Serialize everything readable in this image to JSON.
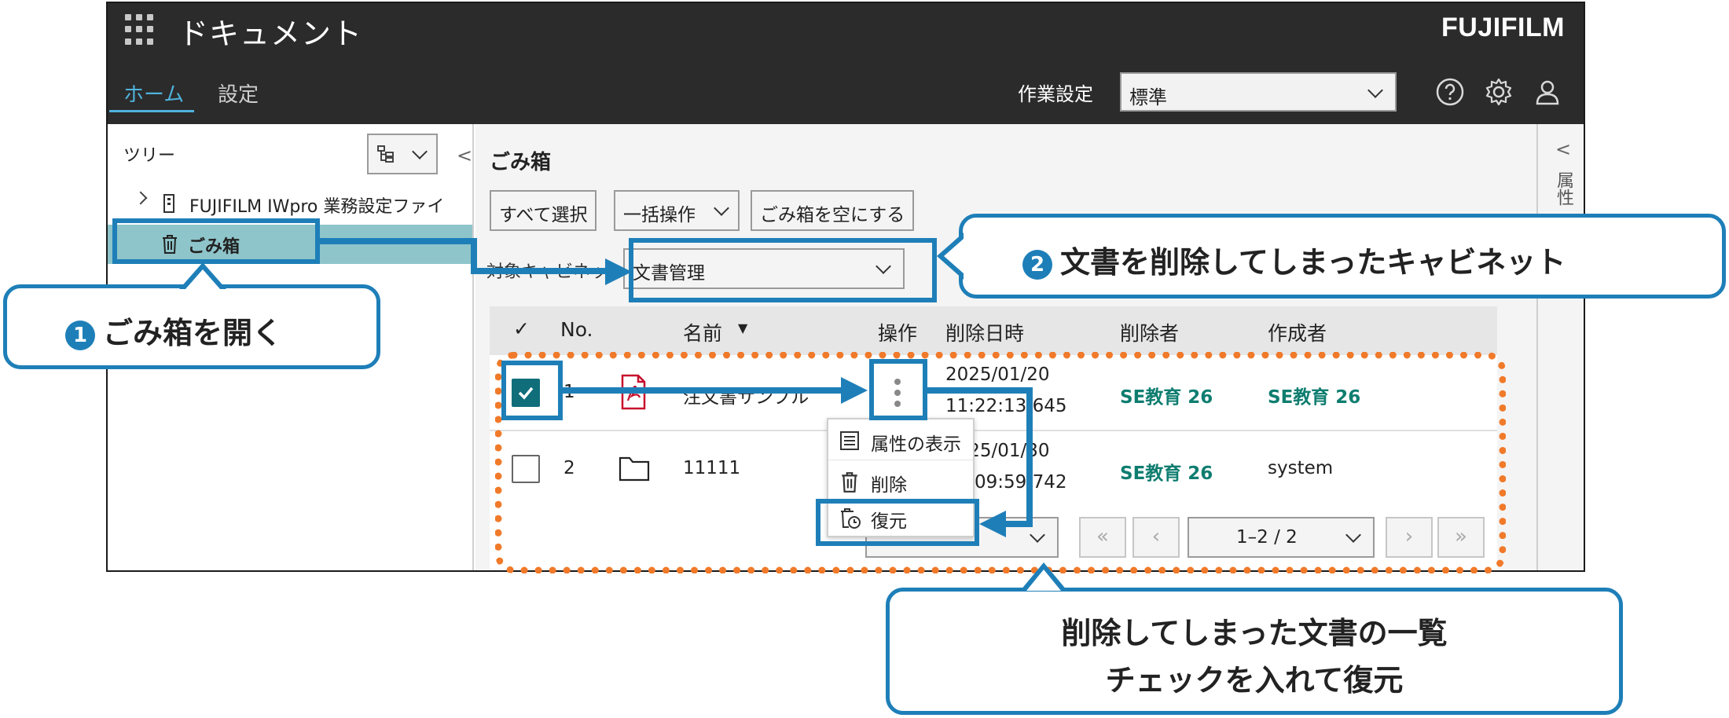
{
  "app": {
    "title": "ドキュメント",
    "brand": "FUJIFILM",
    "nav": {
      "home": "ホーム",
      "settings": "設定"
    },
    "work_setting_label": "作業設定",
    "work_setting_value": "標準"
  },
  "tree": {
    "label": "ツリー",
    "items": [
      {
        "label": "FUJIFILM IWpro 業務設定ファイ"
      },
      {
        "label": "ごみ箱"
      }
    ]
  },
  "right_pane": {
    "label": "属性"
  },
  "main": {
    "title": "ごみ箱",
    "buttons": {
      "select_all": "すべて選択",
      "bulk": "一括操作",
      "empty": "ごみ箱を空にする"
    },
    "cabinet_label": "対象キャビネット",
    "cabinet_value": "文書管理",
    "columns": {
      "check": "✓",
      "no": "No.",
      "name": "名前",
      "sort": "▼",
      "op": "操作",
      "deleted_at": "削除日時",
      "deleted_by": "削除者",
      "created_by": "作成者"
    },
    "rows": [
      {
        "no": "1",
        "name": "注文書サンプル",
        "date": "2025/01/20",
        "time": "11:22:13.645",
        "deleted_by": "SE教育 26",
        "created_by": "SE教育 26"
      },
      {
        "no": "2",
        "name": "11111",
        "date": "2025/01/30",
        "time": "15:09:59.742",
        "deleted_by": "SE教育 26",
        "created_by": "system"
      }
    ],
    "pager": {
      "range": "1–2 / 2"
    }
  },
  "menu": {
    "show_attr": "属性の表示",
    "delete": "削除",
    "restore": "復元"
  },
  "callouts": {
    "c1_num": "1",
    "c1_text": "ごみ箱を開く",
    "c2_num": "2",
    "c2_text": "文書を削除してしまったキャビネット",
    "c3_line1": "削除してしまった文書の一覧",
    "c3_line2": "チェックを入れて復元"
  }
}
